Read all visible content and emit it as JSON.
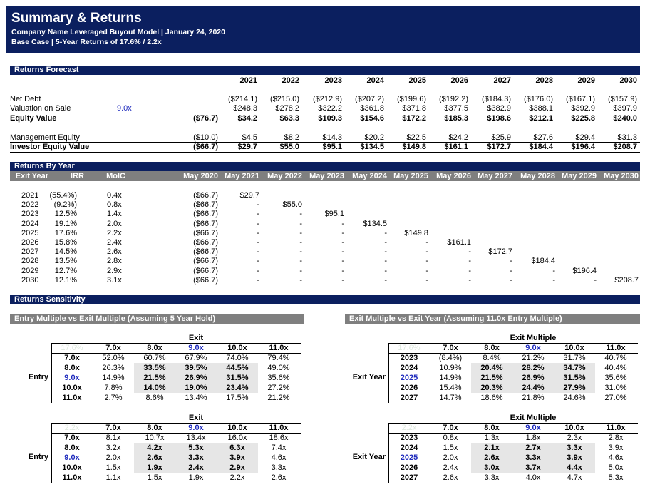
{
  "header": {
    "title": "Summary & Returns",
    "subtitle1": "Company Name Leveraged Buyout Model | January 24, 2020",
    "subtitle2": "Base Case | 5-Year Returns of 17.6%  / 2.2x"
  },
  "forecast": {
    "section_title": "Returns Forecast",
    "years": [
      "2021",
      "2022",
      "2023",
      "2024",
      "2025",
      "2026",
      "2027",
      "2028",
      "2029",
      "2030"
    ],
    "net_debt": {
      "label": "Net Debt",
      "base": "",
      "values": [
        "($214.1)",
        "($215.0)",
        "($212.9)",
        "($207.2)",
        "($199.6)",
        "($192.2)",
        "($184.3)",
        "($176.0)",
        "($167.1)",
        "($157.9)"
      ]
    },
    "valuation": {
      "label": "Valuation on Sale",
      "multiple": "9.0x",
      "base": "",
      "values": [
        "$248.3",
        "$278.2",
        "$322.2",
        "$361.8",
        "$371.8",
        "$377.5",
        "$382.9",
        "$388.1",
        "$392.9",
        "$397.9"
      ]
    },
    "equity_value": {
      "label": "Equity Value",
      "base": "($76.7)",
      "values": [
        "$34.2",
        "$63.3",
        "$109.3",
        "$154.6",
        "$172.2",
        "$185.3",
        "$198.6",
        "$212.1",
        "$225.8",
        "$240.0"
      ]
    },
    "mgmt_equity": {
      "label": "Management Equity",
      "base": "($10.0)",
      "values": [
        "$4.5",
        "$8.2",
        "$14.3",
        "$20.2",
        "$22.5",
        "$24.2",
        "$25.9",
        "$27.6",
        "$29.4",
        "$31.3"
      ]
    },
    "investor_equity": {
      "label": "Investor Equity Value",
      "base": "($66.7)",
      "values": [
        "$29.7",
        "$55.0",
        "$95.1",
        "$134.5",
        "$149.8",
        "$161.1",
        "$172.7",
        "$184.4",
        "$196.4",
        "$208.7"
      ]
    }
  },
  "by_year": {
    "section_title": "Returns By Year",
    "headers": [
      "Exit Year",
      "IRR",
      "MoIC",
      "May 2020",
      "May 2021",
      "May 2022",
      "May 2023",
      "May 2024",
      "May 2025",
      "May 2026",
      "May 2027",
      "May 2028",
      "May 2029",
      "May 2030"
    ],
    "rows": [
      {
        "year": "2021",
        "irr": "(55.4%)",
        "moic": "0.4x",
        "base": "($66.7)",
        "cells": [
          "$29.7",
          "",
          "",
          "",
          "",
          "",
          "",
          "",
          "",
          ""
        ]
      },
      {
        "year": "2022",
        "irr": "(9.2%)",
        "moic": "0.8x",
        "base": "($66.7)",
        "cells": [
          "-",
          "$55.0",
          "",
          "",
          "",
          "",
          "",
          "",
          "",
          ""
        ]
      },
      {
        "year": "2023",
        "irr": "12.5%",
        "moic": "1.4x",
        "base": "($66.7)",
        "cells": [
          "-",
          "-",
          "$95.1",
          "",
          "",
          "",
          "",
          "",
          "",
          ""
        ]
      },
      {
        "year": "2024",
        "irr": "19.1%",
        "moic": "2.0x",
        "base": "($66.7)",
        "cells": [
          "-",
          "-",
          "-",
          "$134.5",
          "",
          "",
          "",
          "",
          "",
          ""
        ]
      },
      {
        "year": "2025",
        "irr": "17.6%",
        "moic": "2.2x",
        "base": "($66.7)",
        "cells": [
          "-",
          "-",
          "-",
          "-",
          "$149.8",
          "",
          "",
          "",
          "",
          ""
        ]
      },
      {
        "year": "2026",
        "irr": "15.8%",
        "moic": "2.4x",
        "base": "($66.7)",
        "cells": [
          "-",
          "-",
          "-",
          "-",
          "-",
          "$161.1",
          "",
          "",
          "",
          ""
        ]
      },
      {
        "year": "2027",
        "irr": "14.5%",
        "moic": "2.6x",
        "base": "($66.7)",
        "cells": [
          "-",
          "-",
          "-",
          "-",
          "-",
          "-",
          "$172.7",
          "",
          "",
          ""
        ]
      },
      {
        "year": "2028",
        "irr": "13.5%",
        "moic": "2.8x",
        "base": "($66.7)",
        "cells": [
          "-",
          "-",
          "-",
          "-",
          "-",
          "-",
          "-",
          "$184.4",
          "",
          ""
        ]
      },
      {
        "year": "2029",
        "irr": "12.7%",
        "moic": "2.9x",
        "base": "($66.7)",
        "cells": [
          "-",
          "-",
          "-",
          "-",
          "-",
          "-",
          "-",
          "-",
          "$196.4",
          ""
        ]
      },
      {
        "year": "2030",
        "irr": "12.1%",
        "moic": "3.1x",
        "base": "($66.7)",
        "cells": [
          "-",
          "-",
          "-",
          "-",
          "-",
          "-",
          "-",
          "-",
          "-",
          "$208.7"
        ]
      }
    ]
  },
  "sensitivity": {
    "section_title": "Returns Sensitivity",
    "left_title": "Entry Multiple vs Exit Multiple (Assuming 5 Year Hold)",
    "right_title": "Exit Multiple vs Exit Year (Assuming 11.0x Entry Multiple)",
    "left": {
      "top_label": "Exit",
      "side_label": "Entry",
      "corner_irr": "17.6%",
      "corner_moic": "2.2x",
      "cols": [
        "7.0x",
        "8.0x",
        "9.0x",
        "10.0x",
        "11.0x"
      ],
      "rows": [
        "7.0x",
        "8.0x",
        "9.0x",
        "10.0x",
        "11.0x"
      ],
      "irr": [
        [
          "52.0%",
          "60.7%",
          "67.9%",
          "74.0%",
          "79.4%"
        ],
        [
          "26.3%",
          "33.5%",
          "39.5%",
          "44.5%",
          "49.0%"
        ],
        [
          "14.9%",
          "21.5%",
          "26.9%",
          "31.5%",
          "35.6%"
        ],
        [
          "7.8%",
          "14.0%",
          "19.0%",
          "23.4%",
          "27.2%"
        ],
        [
          "2.7%",
          "8.6%",
          "13.4%",
          "17.5%",
          "21.2%"
        ]
      ],
      "moic": [
        [
          "8.1x",
          "10.7x",
          "13.4x",
          "16.0x",
          "18.6x"
        ],
        [
          "3.2x",
          "4.2x",
          "5.3x",
          "6.3x",
          "7.4x"
        ],
        [
          "2.0x",
          "2.6x",
          "3.3x",
          "3.9x",
          "4.6x"
        ],
        [
          "1.5x",
          "1.9x",
          "2.4x",
          "2.9x",
          "3.3x"
        ],
        [
          "1.1x",
          "1.5x",
          "1.9x",
          "2.2x",
          "2.6x"
        ]
      ]
    },
    "right": {
      "top_label": "Exit Multiple",
      "side_label": "Exit Year",
      "corner_irr": "17.6%",
      "corner_moic": "2.2x",
      "cols": [
        "7.0x",
        "8.0x",
        "9.0x",
        "10.0x",
        "11.0x"
      ],
      "rows": [
        "2023",
        "2024",
        "2025",
        "2026",
        "2027"
      ],
      "irr": [
        [
          "(8.4%)",
          "8.4%",
          "21.2%",
          "31.7%",
          "40.7%"
        ],
        [
          "10.9%",
          "20.4%",
          "28.2%",
          "34.7%",
          "40.4%"
        ],
        [
          "14.9%",
          "21.5%",
          "26.9%",
          "31.5%",
          "35.6%"
        ],
        [
          "15.4%",
          "20.3%",
          "24.4%",
          "27.9%",
          "31.0%"
        ],
        [
          "14.7%",
          "18.6%",
          "21.8%",
          "24.6%",
          "27.0%"
        ]
      ],
      "moic": [
        [
          "0.8x",
          "1.3x",
          "1.8x",
          "2.3x",
          "2.8x"
        ],
        [
          "1.5x",
          "2.1x",
          "2.7x",
          "3.3x",
          "3.9x"
        ],
        [
          "2.0x",
          "2.6x",
          "3.3x",
          "3.9x",
          "4.6x"
        ],
        [
          "2.4x",
          "3.0x",
          "3.7x",
          "4.4x",
          "5.0x"
        ],
        [
          "2.6x",
          "3.3x",
          "4.0x",
          "4.7x",
          "5.3x"
        ]
      ]
    }
  }
}
